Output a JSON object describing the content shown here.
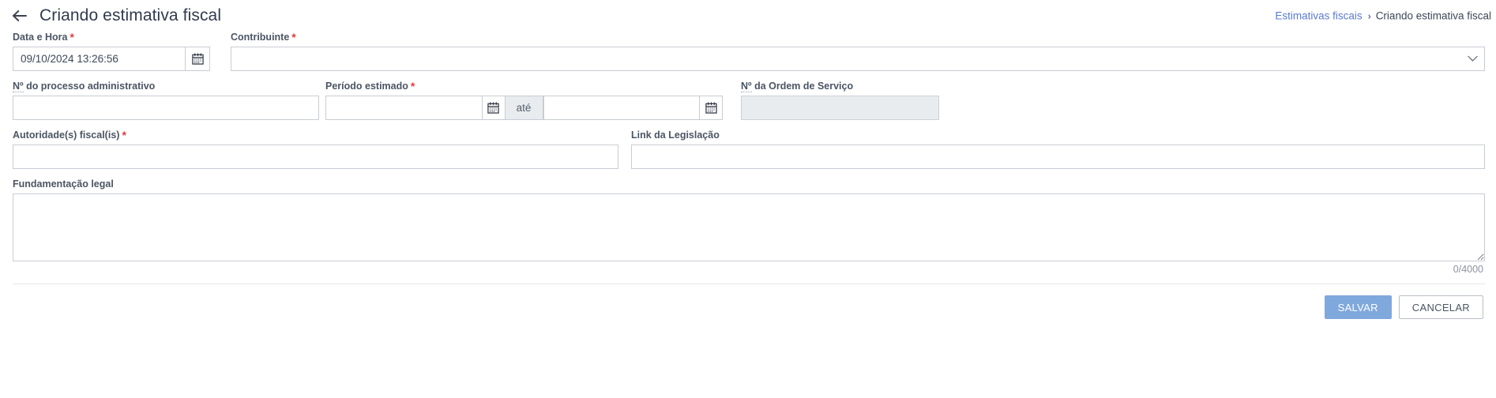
{
  "header": {
    "back_icon": "arrow-left-icon",
    "title": "Criando estimativa fiscal",
    "breadcrumb": {
      "parent": "Estimativas fiscais",
      "separator": "›",
      "current": "Criando estimativa fiscal"
    }
  },
  "form": {
    "data_hora": {
      "label": "Data e Hora",
      "required": "*",
      "value": "09/10/2024 13:26:56",
      "placeholder": "",
      "calendar_icon": "calendar-icon"
    },
    "contribuinte": {
      "label": "Contribuinte",
      "required": "*",
      "value": "",
      "chevron_icon": "chevron-down-icon"
    },
    "processo": {
      "label_abbr": "Nº",
      "label_rest": " do processo administrativo",
      "value": "",
      "placeholder": ""
    },
    "periodo": {
      "label": "Período estimado",
      "required": "*",
      "start_value": "",
      "start_placeholder": "",
      "end_value": "",
      "end_placeholder": "",
      "separator_label": "até",
      "calendar_icon": "calendar-icon"
    },
    "ordem_servico": {
      "label_abbr": "Nº",
      "label_rest": " da Ordem de Serviço",
      "value": "",
      "placeholder": "",
      "disabled": "true"
    },
    "autoridade": {
      "label": "Autoridade(s) fiscal(is)",
      "required": "*",
      "value": "",
      "placeholder": ""
    },
    "link_legislacao": {
      "label": "Link da Legislação",
      "value": "",
      "placeholder": ""
    },
    "fundamentacao": {
      "label": "Fundamentação legal",
      "value": "",
      "placeholder": "",
      "char_count": "0/4000"
    }
  },
  "footer": {
    "save_label": "SALVAR",
    "cancel_label": "CANCELAR"
  },
  "colors": {
    "primary_button": "#7fa8dd",
    "link": "#5b7bd5",
    "required_marker": "#e03b3b",
    "disabled_bg": "#e9ecef",
    "border": "#c8cdd4"
  }
}
